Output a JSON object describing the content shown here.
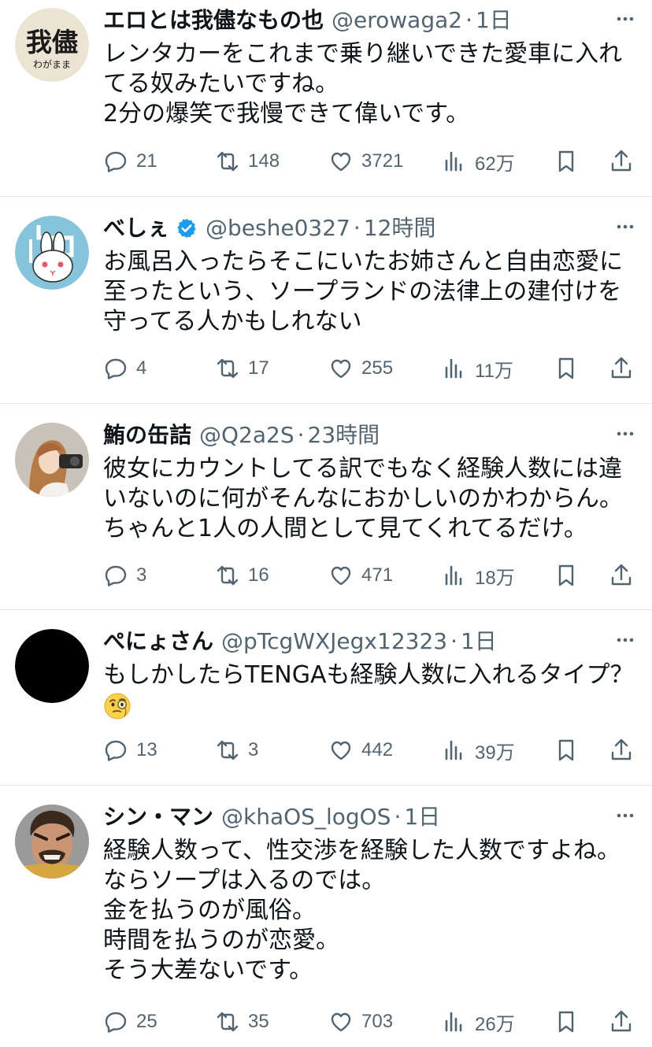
{
  "tweets": [
    {
      "name": "エロとは我儘なもの也",
      "handle": "@erowaga2",
      "time": "1日",
      "verified": false,
      "avatar": {
        "type": "kanji-logo",
        "main_text": "我儘",
        "sub_text": "わがまま"
      },
      "lines": [
        "レンタカーをこれまで乗り継いできた愛車に入れ",
        "てる奴みたいですね。",
        "2分の爆笑で我慢できて偉いです。"
      ],
      "stats": {
        "replies": "21",
        "retweets": "148",
        "likes": "3721",
        "views": "62万"
      }
    },
    {
      "name": "べしぇ",
      "handle": "@beshe0327",
      "time": "12時間",
      "verified": true,
      "avatar": {
        "type": "rabbit"
      },
      "lines": [
        "お風呂入ったらそこにいたお姉さんと自由恋愛に",
        "至ったという、ソープランドの法律上の建付けを",
        "守ってる人かもしれない"
      ],
      "stats": {
        "replies": "4",
        "retweets": "17",
        "likes": "255",
        "views": "11万"
      }
    },
    {
      "name": "鮪の缶詰",
      "handle": "@Q2a2S",
      "time": "23時間",
      "verified": false,
      "avatar": {
        "type": "photo-person"
      },
      "lines": [
        "彼女にカウントしてる訳でもなく経験人数には違",
        "いないのに何がそんなにおかしいのかわからん。",
        "ちゃんと1人の人間として見てくれてるだけ。"
      ],
      "stats": {
        "replies": "3",
        "retweets": "16",
        "likes": "471",
        "views": "18万"
      }
    },
    {
      "name": "ぺにょさん",
      "handle": "@pTcgWXJegx12323",
      "time": "1日",
      "verified": false,
      "avatar": {
        "type": "black-circle"
      },
      "lines": [
        "もしかしたらTENGAも経験人数に入れるタイプ？"
      ],
      "emoji": "monocle-face",
      "stats": {
        "replies": "13",
        "retweets": "3",
        "likes": "442",
        "views": "39万"
      }
    },
    {
      "name": "シン・マン",
      "handle": "@khaOS_logOS",
      "time": "1日",
      "verified": false,
      "avatar": {
        "type": "photo-face"
      },
      "lines": [
        "経験人数って、性交渉を経験した人数ですよね。",
        "ならソープは入るのでは。",
        "金を払うのが風俗。",
        "時間を払うのが恋愛。",
        "そう大差ないです。"
      ],
      "stats": {
        "replies": "25",
        "retweets": "35",
        "likes": "703",
        "views": "26万"
      }
    }
  ],
  "icons": {
    "reply": "reply-icon",
    "retweet": "retweet-icon",
    "like": "like-icon",
    "views": "views-icon",
    "bookmark": "bookmark-icon",
    "share": "share-icon",
    "more": "more-icon"
  },
  "colors": {
    "text": "#0f1419",
    "secondary": "#536471",
    "divider": "#e6e9eb",
    "verified": "#1d9bf0"
  }
}
